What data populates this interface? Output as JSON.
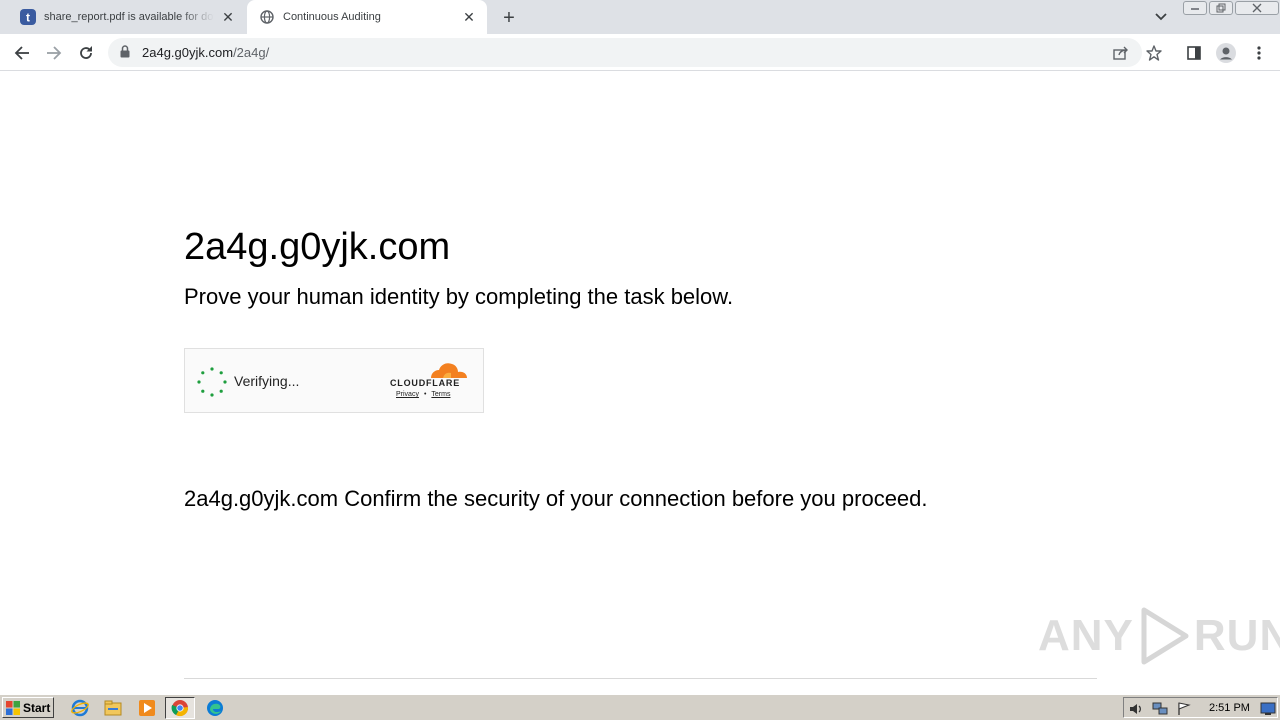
{
  "browser": {
    "tabs": [
      {
        "title": "share_report.pdf is available for download",
        "favicon": "tumblr-icon",
        "active": false
      },
      {
        "title": "Continuous Auditing",
        "favicon": "globe-icon",
        "active": true
      }
    ],
    "address_bar": {
      "host": "2a4g.g0yjk.com",
      "path": "/2a4g/"
    }
  },
  "page": {
    "heading": "2a4g.g0yjk.com",
    "subtitle": "Prove your human identity by completing the task below.",
    "challenge_widget": {
      "status_text": "Verifying...",
      "brand": "CLOUDFLARE",
      "privacy_link": "Privacy",
      "separator": "•",
      "terms_link": "Terms"
    },
    "message": "2a4g.g0yjk.com Confirm the security of your connection before you proceed."
  },
  "watermark": {
    "left": "ANY",
    "right": "RUN"
  },
  "taskbar": {
    "start_label": "Start",
    "apps": [
      "ie-icon",
      "explorer-icon",
      "media-player-icon",
      "chrome-icon",
      "edge-icon"
    ],
    "clock": "2:51 PM"
  },
  "colors": {
    "cloudflare_orange": "#f38020",
    "spinner_green": "#1e9e3e"
  }
}
